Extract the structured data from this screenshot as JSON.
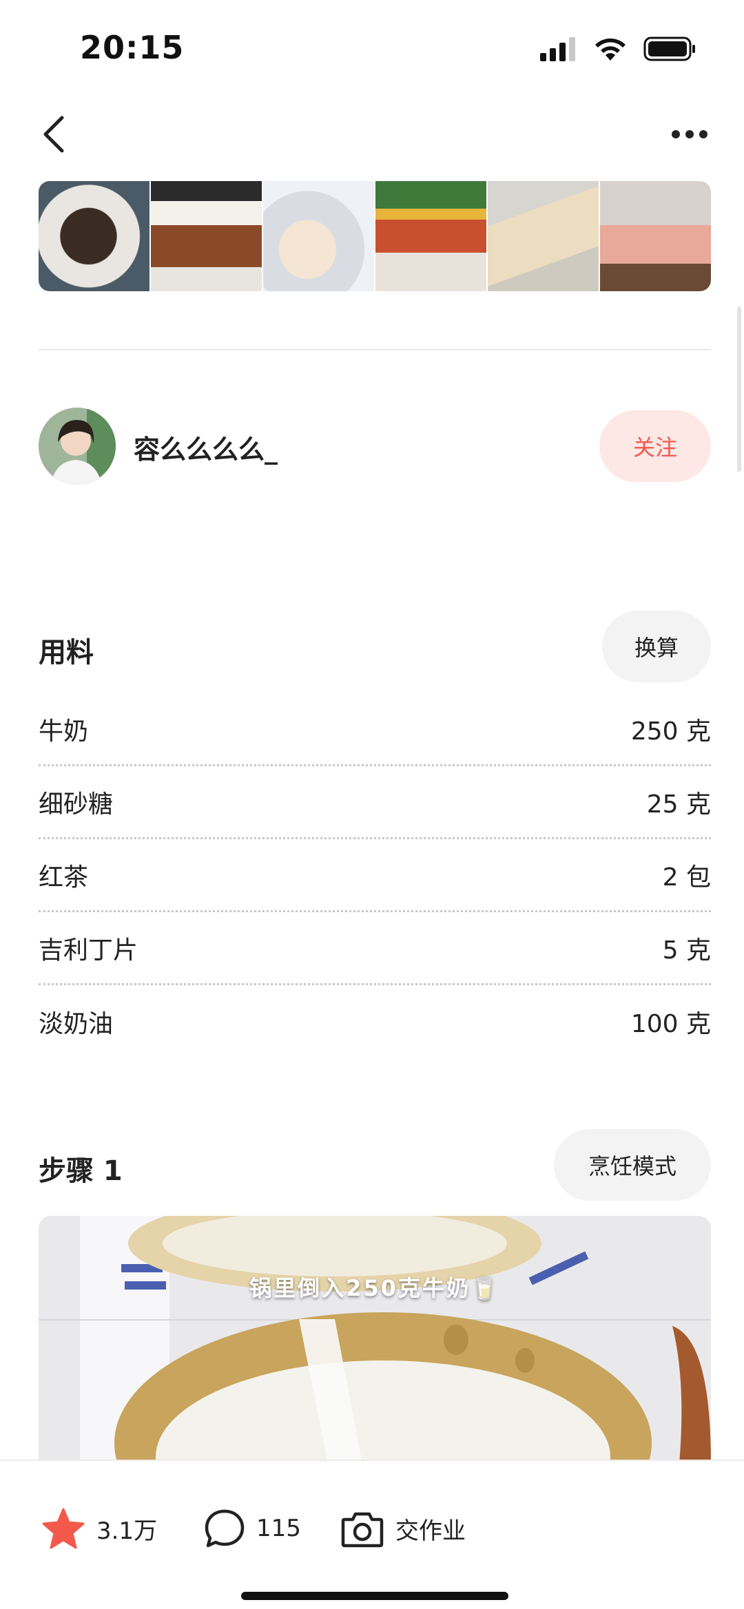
{
  "status_bar": {
    "time": "20:15"
  },
  "nav": {
    "back_icon": "chevron-left-icon",
    "more_icon": "more-dots-icon"
  },
  "thumbnails": [
    {
      "icon": "photo-oreo-mix"
    },
    {
      "icon": "photo-milk-tea-cups"
    },
    {
      "icon": "photo-pudding-bowl"
    },
    {
      "icon": "photo-table-sunflowers"
    },
    {
      "icon": "photo-tofu-pudding"
    },
    {
      "icon": "photo-dessert-cups"
    }
  ],
  "author": {
    "name": "容么么么么_",
    "follow_label": "关注"
  },
  "ingredients_section": {
    "title": "用料",
    "convert_label": "换算",
    "items": [
      {
        "name": "牛奶",
        "amount": "250 克"
      },
      {
        "name": "细砂糖",
        "amount": "25 克"
      },
      {
        "name": "红茶",
        "amount": "2 包"
      },
      {
        "name": "吉利丁片",
        "amount": "5 克"
      },
      {
        "name": "淡奶油",
        "amount": "100 克"
      }
    ]
  },
  "step": {
    "title": "步骤 1",
    "mode_label": "烹饪模式",
    "image_caption": "锅里倒入250克牛奶🥛"
  },
  "bottom_bar": {
    "favorite_count": "3.1万",
    "comment_count": "115",
    "homework_label": "交作业"
  },
  "colors": {
    "accent": "#f2594b",
    "follow_bg": "#fde8e6",
    "pill_bg": "#f3f3f3"
  }
}
